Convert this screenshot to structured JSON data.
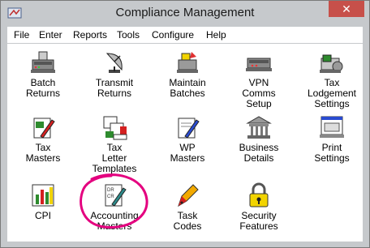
{
  "window": {
    "title": "Compliance Management",
    "close_label": "✕"
  },
  "menu": [
    "File",
    "Enter",
    "Reports",
    "Tools",
    "Configure",
    "Help"
  ],
  "tiles": [
    [
      "Batch",
      "Returns"
    ],
    [
      "Transmit",
      "Returns"
    ],
    [
      "Maintain",
      "Batches"
    ],
    [
      "VPN",
      "Comms",
      "Setup"
    ],
    [
      "Tax",
      "Lodgement",
      "Settings"
    ],
    [
      "Tax",
      "Masters"
    ],
    [
      "Tax",
      "Letter",
      "Templates"
    ],
    [
      "WP",
      "Masters"
    ],
    [
      "Business",
      "Details"
    ],
    [
      "Print",
      "Settings"
    ],
    [
      "CPI"
    ],
    [
      "Accounting",
      "Masters"
    ],
    [
      "Task",
      "Codes"
    ],
    [
      "Security",
      "Features"
    ]
  ],
  "colors": {
    "accent": "#e4007f",
    "chrome": "#c6c9cc",
    "close": "#c7504a"
  }
}
